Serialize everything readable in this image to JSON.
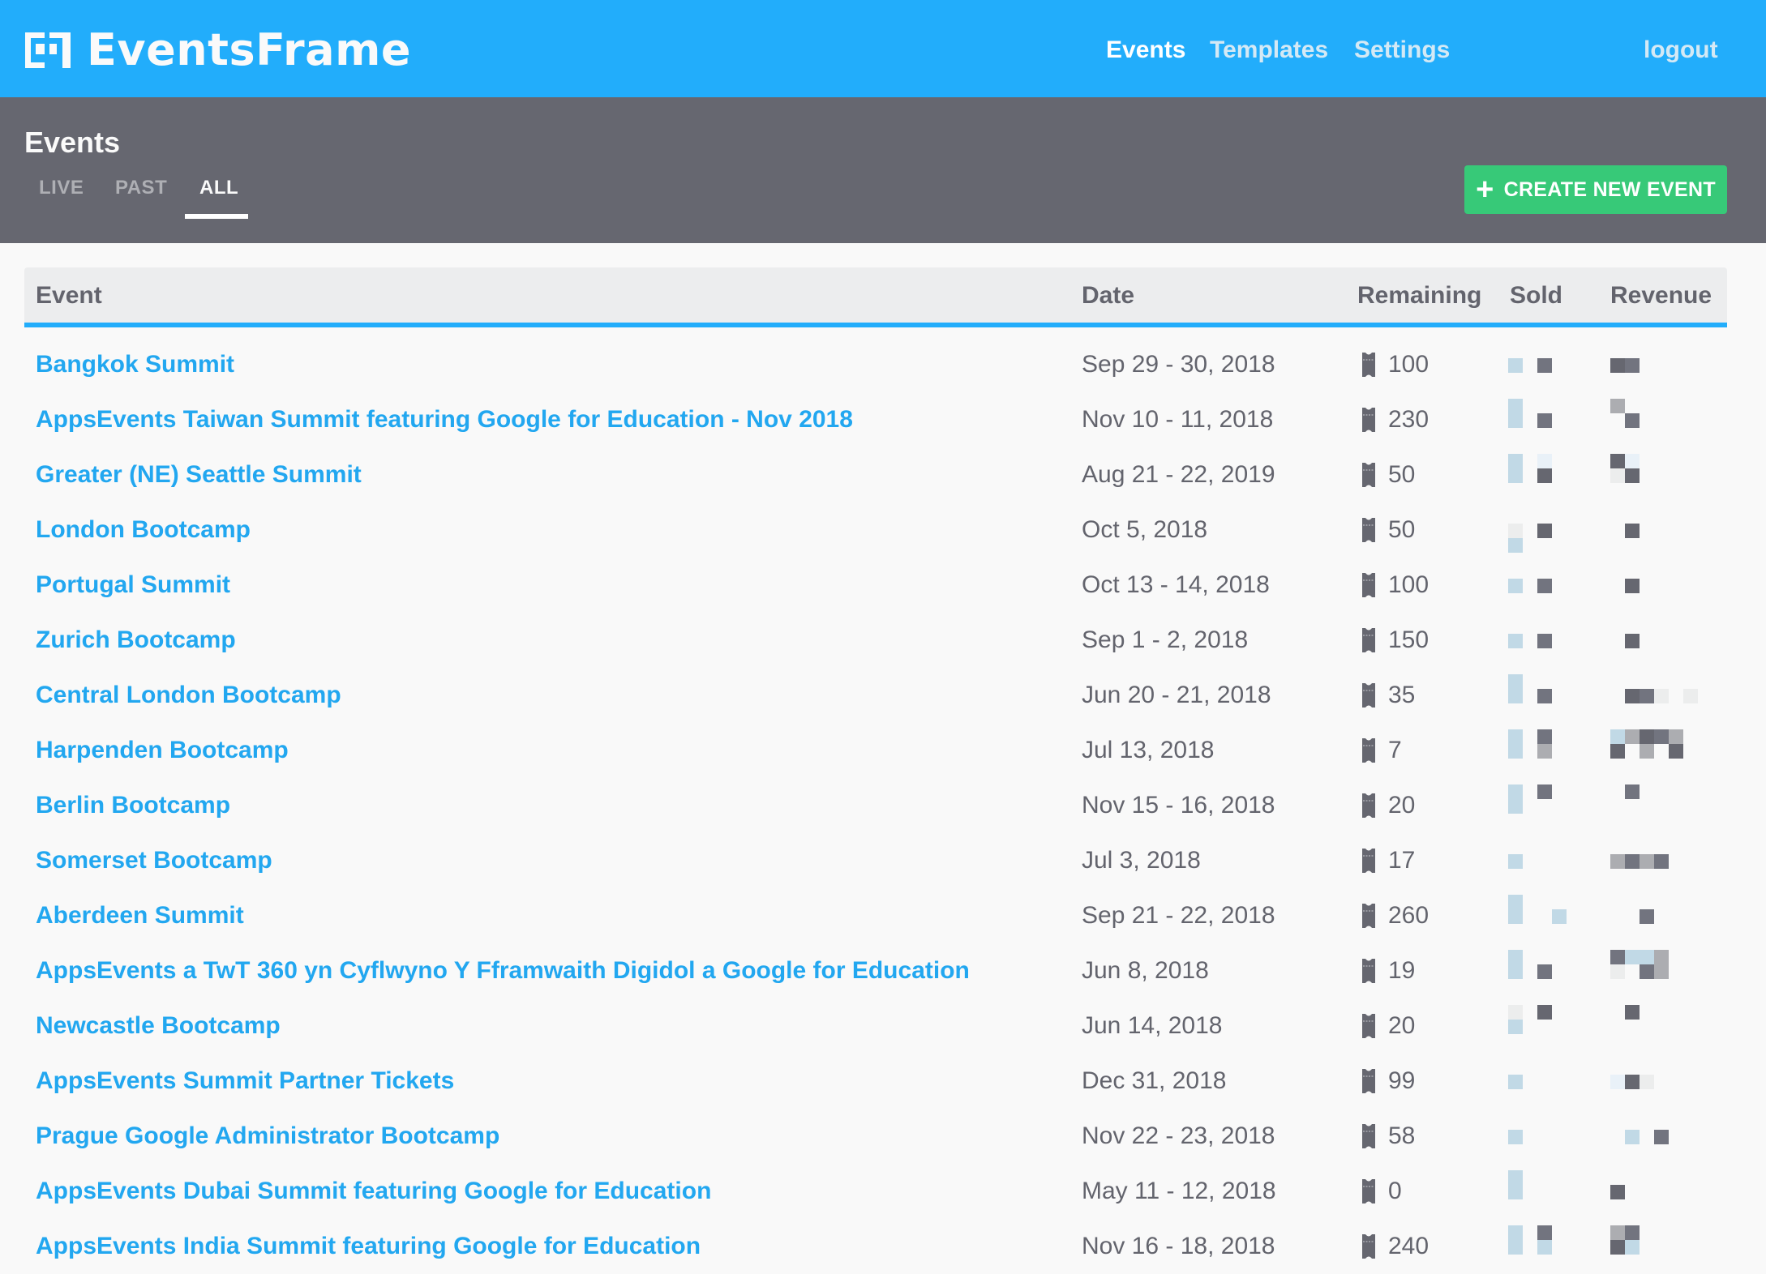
{
  "app": {
    "brand": "EventsFrame",
    "brand_color": "#22adfb"
  },
  "nav": {
    "items": [
      {
        "label": "Events",
        "active": true
      },
      {
        "label": "Templates",
        "active": false
      },
      {
        "label": "Settings",
        "active": false
      }
    ],
    "logout_label": "logout"
  },
  "page": {
    "title": "Events",
    "tabs": [
      {
        "label": "LIVE",
        "active": false
      },
      {
        "label": "PAST",
        "active": false
      },
      {
        "label": "ALL",
        "active": true
      }
    ],
    "create_button_label": "CREATE NEW EVENT",
    "create_button_color": "#37c978"
  },
  "table": {
    "columns": [
      "Event",
      "Date",
      "Remaining",
      "Sold",
      "Revenue"
    ],
    "rows": [
      {
        "name": "Bangkok Summit",
        "date": "Sep 29 - 30, 2018",
        "remaining": "100",
        "sold_redacted": [
          [
            0,
            0,
            "#c1d9e6"
          ],
          [
            2,
            0,
            "#72747f"
          ]
        ],
        "revenue_redacted": [
          [
            0,
            0,
            "#666770"
          ],
          [
            1,
            0,
            "#72747f"
          ]
        ]
      },
      {
        "name": "AppsEvents Taiwan Summit featuring Google for Education - Nov 2018",
        "date": "Nov 10 - 11, 2018",
        "remaining": "230",
        "sold_redacted": [
          [
            0,
            -1,
            "#c1d9e6"
          ],
          [
            0,
            0,
            "#c1d9e6"
          ],
          [
            2,
            0,
            "#72747f"
          ]
        ],
        "revenue_redacted": [
          [
            0,
            -1,
            "#acadb1"
          ],
          [
            1,
            0,
            "#72747f"
          ]
        ]
      },
      {
        "name": "Greater (NE) Seattle Summit",
        "date": "Aug 21 - 22, 2019",
        "remaining": "50",
        "sold_redacted": [
          [
            0,
            -1,
            "#c1d9e6"
          ],
          [
            0,
            0,
            "#c1d9e6"
          ],
          [
            2,
            -1,
            "#e9f1f8"
          ],
          [
            2,
            0,
            "#666770"
          ]
        ],
        "revenue_redacted": [
          [
            0,
            -1,
            "#666770"
          ],
          [
            1,
            -1,
            "#e9f1f8"
          ],
          [
            0,
            0,
            "#eceded"
          ],
          [
            1,
            0,
            "#666770"
          ]
        ]
      },
      {
        "name": "London Bootcamp",
        "date": "Oct 5, 2018",
        "remaining": "50",
        "sold_redacted": [
          [
            0,
            0,
            "#eceded"
          ],
          [
            0,
            1,
            "#c1d9e6"
          ],
          [
            2,
            0,
            "#666770"
          ]
        ],
        "revenue_redacted": [
          [
            1,
            0,
            "#666770"
          ]
        ]
      },
      {
        "name": "Portugal Summit",
        "date": "Oct 13 - 14, 2018",
        "remaining": "100",
        "sold_redacted": [
          [
            0,
            0,
            "#c1d9e6"
          ],
          [
            2,
            0,
            "#72747f"
          ]
        ],
        "revenue_redacted": [
          [
            1,
            0,
            "#666770"
          ]
        ]
      },
      {
        "name": "Zurich Bootcamp",
        "date": "Sep 1 - 2, 2018",
        "remaining": "150",
        "sold_redacted": [
          [
            0,
            0,
            "#c1d9e6"
          ],
          [
            2,
            0,
            "#72747f"
          ]
        ],
        "revenue_redacted": [
          [
            1,
            0,
            "#666770"
          ]
        ]
      },
      {
        "name": "Central London Bootcamp",
        "date": "Jun 20 - 21, 2018",
        "remaining": "35",
        "sold_redacted": [
          [
            0,
            -1,
            "#c1d9e6"
          ],
          [
            0,
            0,
            "#c1d9e6"
          ],
          [
            2,
            0,
            "#72747f"
          ]
        ],
        "revenue_redacted": [
          [
            1,
            0,
            "#666770"
          ],
          [
            2,
            0,
            "#72747f"
          ],
          [
            3,
            0,
            "#eceded"
          ],
          [
            5,
            0,
            "#eceded"
          ]
        ]
      },
      {
        "name": "Harpenden Bootcamp",
        "date": "Jul 13, 2018",
        "remaining": "7",
        "sold_redacted": [
          [
            0,
            -1,
            "#c1d9e6"
          ],
          [
            0,
            0,
            "#c1d9e6"
          ],
          [
            2,
            -1,
            "#72747f"
          ],
          [
            2,
            0,
            "#acadb1"
          ]
        ],
        "revenue_redacted": [
          [
            0,
            -1,
            "#c1d9e6"
          ],
          [
            1,
            -1,
            "#acadb1"
          ],
          [
            2,
            -1,
            "#666770"
          ],
          [
            3,
            -1,
            "#72747f"
          ],
          [
            4,
            -1,
            "#acadb1"
          ],
          [
            0,
            0,
            "#666770"
          ],
          [
            2,
            0,
            "#acadb1"
          ],
          [
            4,
            0,
            "#666770"
          ]
        ]
      },
      {
        "name": "Berlin Bootcamp",
        "date": "Nov 15 - 16, 2018",
        "remaining": "20",
        "sold_redacted": [
          [
            0,
            -1,
            "#c1d9e6"
          ],
          [
            0,
            0,
            "#c1d9e6"
          ],
          [
            2,
            -1,
            "#72747f"
          ]
        ],
        "revenue_redacted": [
          [
            1,
            -1,
            "#72747f"
          ]
        ]
      },
      {
        "name": "Somerset Bootcamp",
        "date": "Jul 3, 2018",
        "remaining": "17",
        "sold_redacted": [
          [
            0,
            0,
            "#c1d9e6"
          ]
        ],
        "revenue_redacted": [
          [
            0,
            0,
            "#acadb1"
          ],
          [
            1,
            0,
            "#72747f"
          ],
          [
            2,
            0,
            "#acadb1"
          ],
          [
            3,
            0,
            "#72747f"
          ]
        ]
      },
      {
        "name": "Aberdeen Summit",
        "date": "Sep 21 - 22, 2018",
        "remaining": "260",
        "sold_redacted": [
          [
            0,
            -1,
            "#c1d9e6"
          ],
          [
            0,
            0,
            "#c1d9e6"
          ],
          [
            3,
            0,
            "#c1d9e6"
          ]
        ],
        "revenue_redacted": [
          [
            2,
            0,
            "#72747f"
          ]
        ]
      },
      {
        "name": "AppsEvents a TwT 360 yn Cyflwyno Y Fframwaith Digidol a Google for Education",
        "date": "Jun 8, 2018",
        "remaining": "19",
        "sold_redacted": [
          [
            0,
            -1,
            "#c1d9e6"
          ],
          [
            0,
            0,
            "#c1d9e6"
          ],
          [
            2,
            0,
            "#72747f"
          ]
        ],
        "revenue_redacted": [
          [
            0,
            -1,
            "#72747f"
          ],
          [
            1,
            -1,
            "#c1d9e6"
          ],
          [
            2,
            -1,
            "#c1d9e6"
          ],
          [
            3,
            -1,
            "#acadb1"
          ],
          [
            0,
            0,
            "#eceded"
          ],
          [
            2,
            0,
            "#72747f"
          ],
          [
            3,
            0,
            "#acadb1"
          ]
        ]
      },
      {
        "name": "Newcastle Bootcamp",
        "date": "Jun 14, 2018",
        "remaining": "20",
        "sold_redacted": [
          [
            0,
            -1,
            "#eceded"
          ],
          [
            0,
            0,
            "#c1d9e6"
          ],
          [
            2,
            -1,
            "#666770"
          ]
        ],
        "revenue_redacted": [
          [
            1,
            -1,
            "#666770"
          ]
        ]
      },
      {
        "name": "AppsEvents Summit Partner Tickets",
        "date": "Dec 31, 2018",
        "remaining": "99",
        "sold_redacted": [
          [
            0,
            0,
            "#c1d9e6"
          ]
        ],
        "revenue_redacted": [
          [
            0,
            0,
            "#e9f1f8"
          ],
          [
            1,
            0,
            "#666770"
          ],
          [
            2,
            0,
            "#eceded"
          ]
        ]
      },
      {
        "name": "Prague Google Administrator Bootcamp",
        "date": "Nov 22 - 23, 2018",
        "remaining": "58",
        "sold_redacted": [
          [
            0,
            0,
            "#c1d9e6"
          ]
        ],
        "revenue_redacted": [
          [
            1,
            0,
            "#c1d9e6"
          ],
          [
            3,
            0,
            "#72747f"
          ]
        ]
      },
      {
        "name": "AppsEvents Dubai Summit featuring Google for Education",
        "date": "May 11 - 12, 2018",
        "remaining": "0",
        "sold_redacted": [
          [
            0,
            -1,
            "#c1d9e6"
          ],
          [
            0,
            0,
            "#c1d9e6"
          ]
        ],
        "revenue_redacted": [
          [
            0,
            0,
            "#666770"
          ]
        ]
      },
      {
        "name": "AppsEvents India Summit featuring Google for Education",
        "date": "Nov 16 - 18, 2018",
        "remaining": "240",
        "sold_redacted": [
          [
            0,
            -1,
            "#c1d9e6"
          ],
          [
            0,
            0,
            "#c1d9e6"
          ],
          [
            2,
            -1,
            "#72747f"
          ],
          [
            2,
            0,
            "#c1d9e6"
          ]
        ],
        "revenue_redacted": [
          [
            0,
            -1,
            "#acadb1"
          ],
          [
            1,
            -1,
            "#72747f"
          ],
          [
            0,
            0,
            "#666770"
          ],
          [
            1,
            0,
            "#c1d9e6"
          ]
        ]
      }
    ]
  }
}
